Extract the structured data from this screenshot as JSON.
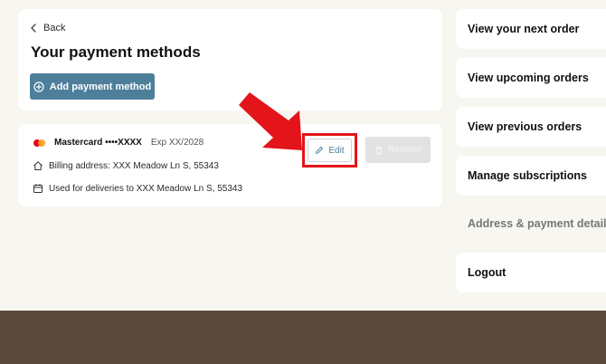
{
  "header": {
    "back_label": "Back",
    "title": "Your payment methods",
    "add_button_label": "Add payment method"
  },
  "payment_method": {
    "brand": "Mastercard",
    "masked_number": "••••XXXX",
    "expiry": "Exp XX/2028",
    "billing_address": "Billing address: XXX Meadow Ln S, 55343",
    "delivery_info": "Used for deliveries to XXX Meadow Ln S, 55343",
    "edit_label": "Edit",
    "remove_label": "Remove"
  },
  "sidebar": {
    "items": [
      {
        "label": "View your next order"
      },
      {
        "label": "View upcoming orders"
      },
      {
        "label": "View previous orders"
      },
      {
        "label": "Manage subscriptions"
      },
      {
        "label": "Address & payment details",
        "current": true
      },
      {
        "label": "Logout"
      }
    ]
  },
  "colors": {
    "page_background": "#f8f6f1",
    "footer": "#5c4a3e",
    "primary_button": "#4d7f9b",
    "highlight": "#e3141a",
    "disabled_button": "#e2e2e2"
  },
  "icons": {
    "back": "chevron-left-icon",
    "add": "plus-circle-icon",
    "card_brand": "mastercard-logo-icon",
    "billing": "home-icon",
    "delivery": "calendar-icon",
    "edit": "pencil-icon",
    "remove": "trash-icon"
  }
}
